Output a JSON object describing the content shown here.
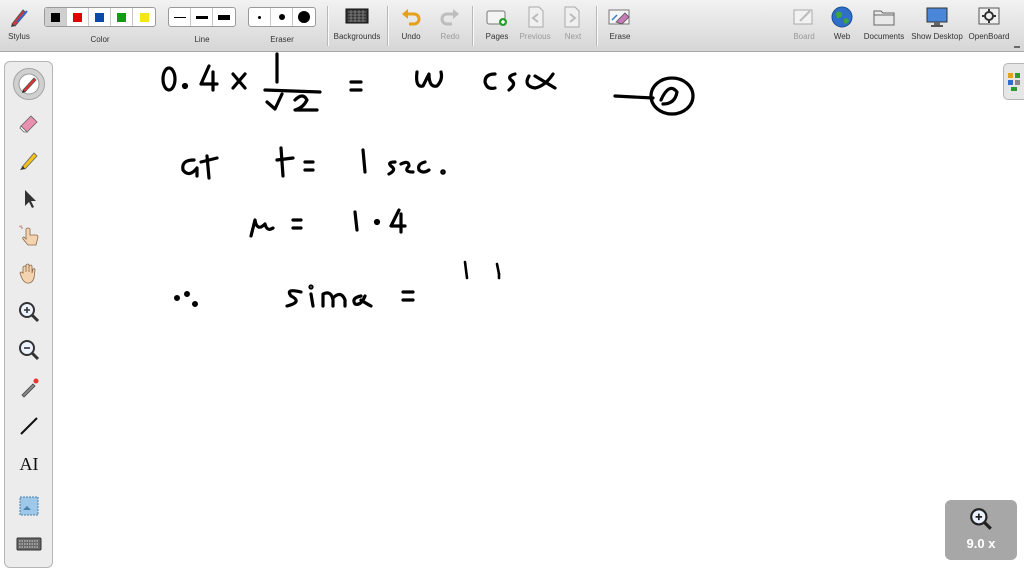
{
  "toolbar": {
    "stylus_label": "Stylus",
    "color_label": "Color",
    "line_label": "Line",
    "eraser_label": "Eraser",
    "backgrounds_label": "Backgrounds",
    "undo_label": "Undo",
    "redo_label": "Redo",
    "pages_label": "Pages",
    "previous_label": "Previous",
    "next_label": "Next",
    "erase_label": "Erase",
    "board_label": "Board",
    "web_label": "Web",
    "documents_label": "Documents",
    "show_desktop_label": "Show Desktop",
    "openboard_label": "OpenBoard"
  },
  "colors": {
    "palette": [
      "#000000",
      "#e00000",
      "#0b4aa8",
      "#119c11",
      "#f5e61a"
    ],
    "ink": "#000000",
    "toolbar_bg": "#e2e2e2",
    "zoom_bg": "#a7a7a7"
  },
  "sidebar": {
    "tools": [
      "pen-icon",
      "eraser-icon",
      "marker-icon",
      "selector-icon",
      "interact-icon",
      "hand-icon",
      "zoom-in-icon",
      "zoom-out-icon",
      "laser-pointer-icon",
      "line-icon",
      "text-icon",
      "capture-icon",
      "keyboard-icon"
    ],
    "text_tool_label": "AI"
  },
  "zoom": {
    "level": "9.0 x"
  },
  "board": {
    "handwriting": [
      "0.4 x 1/√2 = ω cos α",
      "at t = 1 sec.",
      "μ = 1.4",
      "∴ sin α =",
      "1.4"
    ]
  }
}
